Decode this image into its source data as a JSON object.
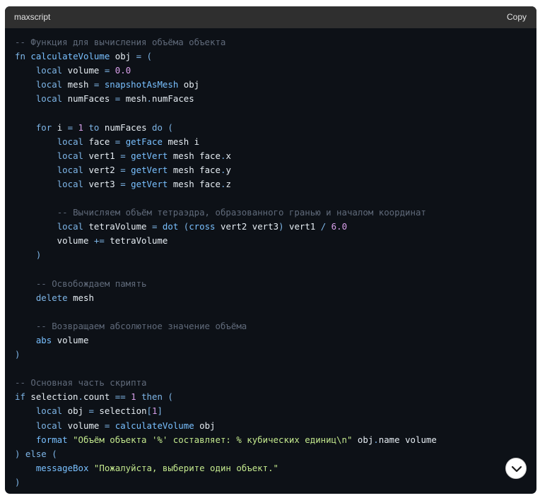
{
  "header": {
    "language": "maxscript",
    "copy_label": "Copy"
  },
  "code_lines": [
    [
      [
        "comment",
        "-- Функция для вычисления объёма объекта"
      ]
    ],
    [
      [
        "kw",
        "fn "
      ],
      [
        "fn",
        "calculateVolume"
      ],
      [
        "id",
        " obj "
      ],
      [
        "op",
        "="
      ],
      [
        "br",
        " ("
      ]
    ],
    [
      [
        "id",
        "    "
      ],
      [
        "kw",
        "local"
      ],
      [
        "id",
        " volume "
      ],
      [
        "op",
        "="
      ],
      [
        "num",
        " 0.0"
      ]
    ],
    [
      [
        "id",
        "    "
      ],
      [
        "kw",
        "local"
      ],
      [
        "id",
        " mesh "
      ],
      [
        "op",
        "="
      ],
      [
        "fn",
        " snapshotAsMesh"
      ],
      [
        "id",
        " obj"
      ]
    ],
    [
      [
        "id",
        "    "
      ],
      [
        "kw",
        "local"
      ],
      [
        "id",
        " numFaces "
      ],
      [
        "op",
        "="
      ],
      [
        "id",
        " mesh"
      ],
      [
        "op",
        "."
      ],
      [
        "id",
        "numFaces"
      ]
    ],
    [
      [
        "id",
        ""
      ]
    ],
    [
      [
        "id",
        "    "
      ],
      [
        "kw",
        "for"
      ],
      [
        "id",
        " i "
      ],
      [
        "op",
        "="
      ],
      [
        "num",
        " 1"
      ],
      [
        "kw",
        " to"
      ],
      [
        "id",
        " numFaces "
      ],
      [
        "kw",
        "do"
      ],
      [
        "br",
        " ("
      ]
    ],
    [
      [
        "id",
        "        "
      ],
      [
        "kw",
        "local"
      ],
      [
        "id",
        " face "
      ],
      [
        "op",
        "="
      ],
      [
        "fn",
        " getFace"
      ],
      [
        "id",
        " mesh i"
      ]
    ],
    [
      [
        "id",
        "        "
      ],
      [
        "kw",
        "local"
      ],
      [
        "id",
        " vert1 "
      ],
      [
        "op",
        "="
      ],
      [
        "fn",
        " getVert"
      ],
      [
        "id",
        " mesh face"
      ],
      [
        "op",
        "."
      ],
      [
        "id",
        "x"
      ]
    ],
    [
      [
        "id",
        "        "
      ],
      [
        "kw",
        "local"
      ],
      [
        "id",
        " vert2 "
      ],
      [
        "op",
        "="
      ],
      [
        "fn",
        " getVert"
      ],
      [
        "id",
        " mesh face"
      ],
      [
        "op",
        "."
      ],
      [
        "id",
        "y"
      ]
    ],
    [
      [
        "id",
        "        "
      ],
      [
        "kw",
        "local"
      ],
      [
        "id",
        " vert3 "
      ],
      [
        "op",
        "="
      ],
      [
        "fn",
        " getVert"
      ],
      [
        "id",
        " mesh face"
      ],
      [
        "op",
        "."
      ],
      [
        "id",
        "z"
      ]
    ],
    [
      [
        "id",
        ""
      ]
    ],
    [
      [
        "id",
        "        "
      ],
      [
        "comment",
        "-- Вычисляем объём тетраэдра, образованного гранью и началом координат"
      ]
    ],
    [
      [
        "id",
        "        "
      ],
      [
        "kw",
        "local"
      ],
      [
        "id",
        " tetraVolume "
      ],
      [
        "op",
        "="
      ],
      [
        "fn",
        " dot"
      ],
      [
        "br",
        " ("
      ],
      [
        "fn",
        "cross"
      ],
      [
        "id",
        " vert2 vert3"
      ],
      [
        "br",
        ")"
      ],
      [
        "id",
        " vert1 "
      ],
      [
        "op",
        "/"
      ],
      [
        "num",
        " 6.0"
      ]
    ],
    [
      [
        "id",
        "        volume "
      ],
      [
        "op",
        "+="
      ],
      [
        "id",
        " tetraVolume"
      ]
    ],
    [
      [
        "id",
        "    "
      ],
      [
        "br",
        ")"
      ]
    ],
    [
      [
        "id",
        ""
      ]
    ],
    [
      [
        "id",
        "    "
      ],
      [
        "comment",
        "-- Освобождаем память"
      ]
    ],
    [
      [
        "id",
        "    "
      ],
      [
        "kw",
        "delete"
      ],
      [
        "id",
        " mesh"
      ]
    ],
    [
      [
        "id",
        ""
      ]
    ],
    [
      [
        "id",
        "    "
      ],
      [
        "comment",
        "-- Возвращаем абсолютное значение объёма"
      ]
    ],
    [
      [
        "id",
        "    "
      ],
      [
        "fn",
        "abs"
      ],
      [
        "id",
        " volume"
      ]
    ],
    [
      [
        "br",
        ")"
      ]
    ],
    [
      [
        "id",
        ""
      ]
    ],
    [
      [
        "comment",
        "-- Основная часть скрипта"
      ]
    ],
    [
      [
        "kw",
        "if"
      ],
      [
        "id",
        " selection"
      ],
      [
        "op",
        "."
      ],
      [
        "id",
        "count "
      ],
      [
        "op",
        "=="
      ],
      [
        "num",
        " 1"
      ],
      [
        "kw",
        " then"
      ],
      [
        "br",
        " ("
      ]
    ],
    [
      [
        "id",
        "    "
      ],
      [
        "kw",
        "local"
      ],
      [
        "id",
        " obj "
      ],
      [
        "op",
        "="
      ],
      [
        "id",
        " selection"
      ],
      [
        "br",
        "["
      ],
      [
        "num",
        "1"
      ],
      [
        "br",
        "]"
      ]
    ],
    [
      [
        "id",
        "    "
      ],
      [
        "kw",
        "local"
      ],
      [
        "id",
        " volume "
      ],
      [
        "op",
        "="
      ],
      [
        "fn",
        " calculateVolume"
      ],
      [
        "id",
        " obj"
      ]
    ],
    [
      [
        "id",
        "    "
      ],
      [
        "fn",
        "format"
      ],
      [
        "str",
        " \"Объём объекта '%' составляет: % кубических единиц\\n\""
      ],
      [
        "id",
        " obj"
      ],
      [
        "op",
        "."
      ],
      [
        "id",
        "name volume"
      ]
    ],
    [
      [
        "br",
        ")"
      ],
      [
        "kw",
        " else"
      ],
      [
        "br",
        " ("
      ]
    ],
    [
      [
        "id",
        "    "
      ],
      [
        "fn",
        "messageBox"
      ],
      [
        "str",
        " \"Пожалуйста, выберите один объект.\""
      ]
    ],
    [
      [
        "br",
        ")"
      ]
    ]
  ],
  "icons": {
    "scroll_down": "chevron-down-icon"
  }
}
